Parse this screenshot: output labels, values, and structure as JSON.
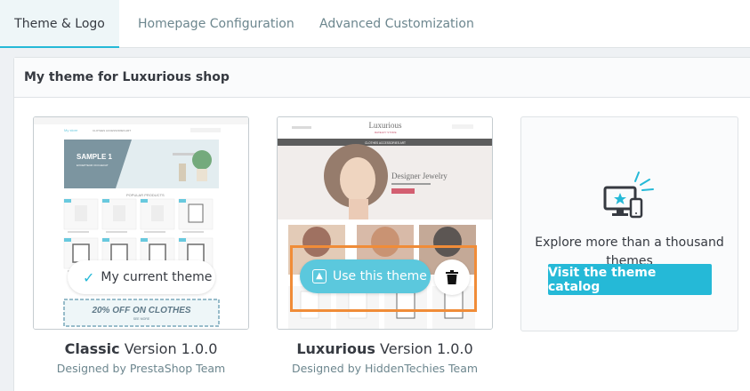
{
  "tabs": [
    {
      "label": "Theme & Logo",
      "active": true
    },
    {
      "label": "Homepage Configuration",
      "active": false
    },
    {
      "label": "Advanced Customization",
      "active": false
    }
  ],
  "card": {
    "title": "My theme for Luxurious shop"
  },
  "themes": [
    {
      "name": "Classic",
      "version": "Version 1.0.0",
      "author": "Designed by PrestaShop Team",
      "status_label": "My current theme",
      "preview": {
        "brand": "My store",
        "nav": "CLOTHES   ACCESSORIES   ART",
        "hero_title": "SAMPLE 1",
        "hero_sub": "EXCEPTEUR OCCAECAT",
        "section": "POPULAR PRODUCTS",
        "promo": "20% OFF ON CLOTHES",
        "promo_sub": "SEE MORE"
      }
    },
    {
      "name": "Luxurious",
      "version": "Version 1.0.0",
      "author": "Designed by HiddenTechies Team",
      "action_label": "Use this theme",
      "preview": {
        "logo": "Luxurious",
        "logo_sub": "JEWELRY STORE",
        "nav": "CLOTHES   ACCESSORIES   ART",
        "hero_title": "Designer Jewelry"
      }
    }
  ],
  "catalog": {
    "text": "Explore more than a thousand themes",
    "button": "Visit the theme catalog"
  },
  "colors": {
    "accent": "#25b9d7",
    "focus": "#f08c38",
    "text": "#363a41",
    "muted": "#6c868e"
  }
}
